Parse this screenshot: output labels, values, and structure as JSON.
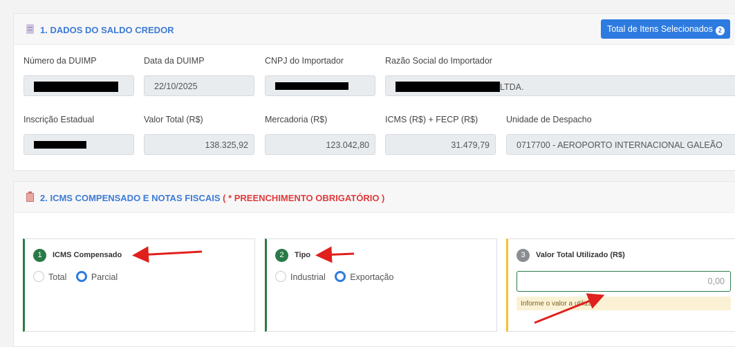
{
  "section1": {
    "title": "1. DADOS DO SALDO CREDOR",
    "total_button": "Total de Itens Selecionados",
    "total_badge": "2",
    "fields": {
      "numero_label": "Número da DUIMP",
      "data_label": "Data da DUIMP",
      "data_value": "22/10/2025",
      "cnpj_label": "CNPJ do Importador",
      "razao_label": "Razão Social do Importador",
      "razao_suffix": "LTDA.",
      "inscricao_label": "Inscrição Estadual",
      "valor_label": "Valor Total (R$)",
      "valor_value": "138.325,92",
      "mercadoria_label": "Mercadoria (R$)",
      "mercadoria_value": "123.042,80",
      "icms_label": "ICMS (R$) + FECP (R$)",
      "icms_value": "31.479,79",
      "unidade_label": "Unidade de Despacho",
      "unidade_value": "0717700 - AEROPORTO INTERNACIONAL GALEÃO"
    }
  },
  "section2": {
    "title": "2. ICMS COMPENSADO E NOTAS FISCAIS",
    "required": "( * PREENCHIMENTO OBRIGATÓRIO )",
    "card1": {
      "step": "1",
      "title": "ICMS Compensado",
      "opt1": "Total",
      "opt2": "Parcial",
      "selected": "Parcial"
    },
    "card2": {
      "step": "2",
      "title": "Tipo",
      "opt1": "Industrial",
      "opt2": "Exportação",
      "selected": "Exportação"
    },
    "card3": {
      "step": "3",
      "title": "Valor Total Utilizado (R$)",
      "placeholder": "0,00",
      "hint": "Informe o valor a utilizar."
    }
  },
  "colors": {
    "accent_blue": "#2d7be0",
    "title_blue": "#3d7bd6",
    "required_red": "#e03a3a",
    "step_green": "#2a7a47",
    "arrow_red": "#e0201c"
  }
}
